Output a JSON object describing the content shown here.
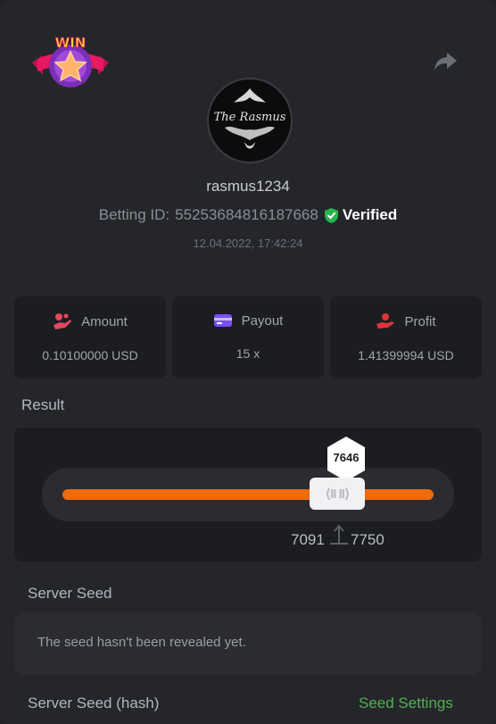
{
  "header": {
    "badge_text": "WIN",
    "share_icon": "share-arrow-icon"
  },
  "profile": {
    "avatar_text": "The Rasmus",
    "username": "rasmus1234",
    "betting_id_label": "Betting ID:",
    "betting_id": "55253684816187668",
    "verified_label": "Verified",
    "timestamp": "12.04.2022, 17:42:24"
  },
  "stats": [
    {
      "label": "Amount",
      "value": "0.10100000 USD",
      "icon": "hand-coins-icon",
      "color": "#e0495e"
    },
    {
      "label": "Payout",
      "value": "15 x",
      "icon": "wallet-card-icon",
      "color": "#7a4ff2"
    },
    {
      "label": "Profit",
      "value": "1.41399994 USD",
      "icon": "profit-hand-icon",
      "color": "#e0333b"
    }
  ],
  "result": {
    "label": "Result",
    "value": "7646",
    "range_low": "7091",
    "range_high": "7750",
    "handle_text": "⟨II II⟩",
    "accent": "#ee6a0a"
  },
  "server_seed": {
    "label": "Server Seed",
    "message": "The seed hasn't been revealed yet."
  },
  "server_seed_hash": {
    "label": "Server Seed (hash)",
    "settings_link": "Seed Settings",
    "link_color": "#4fb24a"
  }
}
